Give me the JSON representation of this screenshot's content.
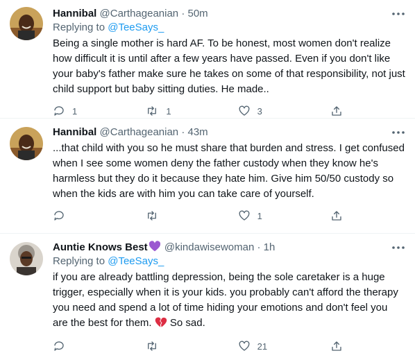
{
  "tweets": [
    {
      "name": "Hannibal",
      "handle": "@Carthageanian",
      "separator": "·",
      "time": "50m",
      "replying_to_label": "Replying to",
      "replying_to_handle": "@TeeSays_",
      "text": "Being a single mother is hard AF. To be honest, most women don't realize how difficult it is until after a few years have passed. Even if you don't like your baby's father make sure he takes on some of that responsibility, not just child support but baby sitting duties. He made..",
      "replies": "1",
      "retweets": "1",
      "likes": "3"
    },
    {
      "name": "Hannibal",
      "handle": "@Carthageanian",
      "separator": "·",
      "time": "43m",
      "text": "...that child with you so he must share that burden and stress. I get confused when I see some women deny the father custody when they know he's harmless but they do it because they hate him. Give him 50/50 custody so when the kids are with him you can take care of yourself.",
      "replies": "",
      "retweets": "",
      "likes": "1"
    },
    {
      "name": "Auntie Knows Best",
      "handle": "@kindawisewoman",
      "separator": "·",
      "time": "1h",
      "replying_to_label": "Replying to",
      "replying_to_handle": "@TeeSays_",
      "text": "if you are already battling depression, being the sole caretaker is a huge trigger, especially when it is your kids. you probably can't afford the therapy you need and spend a lot of time hiding your emotions and don't feel you are the best for them.",
      "text_tail": "So sad.",
      "replies": "",
      "retweets": "",
      "likes": "21"
    }
  ],
  "icons": {
    "more": "more-icon",
    "reply": "reply-icon",
    "retweet": "retweet-icon",
    "like": "like-icon",
    "share": "share-icon",
    "purple_heart": "purple-heart-icon",
    "broken_heart": "broken-heart-icon"
  },
  "colors": {
    "text": "#0f1419",
    "secondary": "#536471",
    "link": "#1d9bf0",
    "purple_heart": "#9b59d0",
    "broken_heart": "#dd2e44",
    "divider": "#eff3f4"
  }
}
